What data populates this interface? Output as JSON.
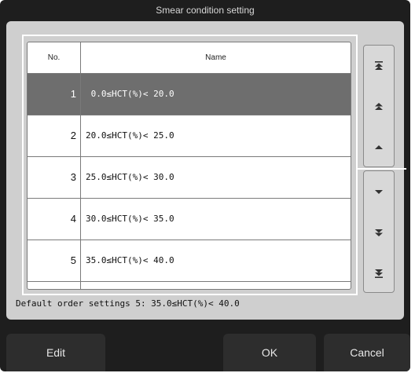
{
  "dialog": {
    "title": "Smear condition setting"
  },
  "table": {
    "headers": {
      "no": "No.",
      "name": "Name"
    },
    "rows": [
      {
        "no": "1",
        "name": " 0.0≤HCT(%)< 20.0",
        "selected": true
      },
      {
        "no": "2",
        "name": "20.0≤HCT(%)< 25.0",
        "selected": false
      },
      {
        "no": "3",
        "name": "25.0≤HCT(%)< 30.0",
        "selected": false
      },
      {
        "no": "4",
        "name": "30.0≤HCT(%)< 35.0",
        "selected": false
      },
      {
        "no": "5",
        "name": "35.0≤HCT(%)< 40.0",
        "selected": false
      }
    ]
  },
  "scroll_buttons": [
    {
      "icon": "scroll-top-icon"
    },
    {
      "icon": "page-up-icon"
    },
    {
      "icon": "line-up-icon"
    },
    {
      "icon": "line-down-icon"
    },
    {
      "icon": "page-down-icon"
    },
    {
      "icon": "scroll-bottom-icon"
    }
  ],
  "default_order": "Default order settings 5: 35.0≤HCT(%)< 40.0",
  "buttons": {
    "edit": "Edit",
    "ok": "OK",
    "cancel": "Cancel"
  },
  "colors": {
    "selected_row": "#6e6e6e",
    "dialog_bg": "#1e1e1e",
    "panel_bg": "#cfcfcf"
  }
}
